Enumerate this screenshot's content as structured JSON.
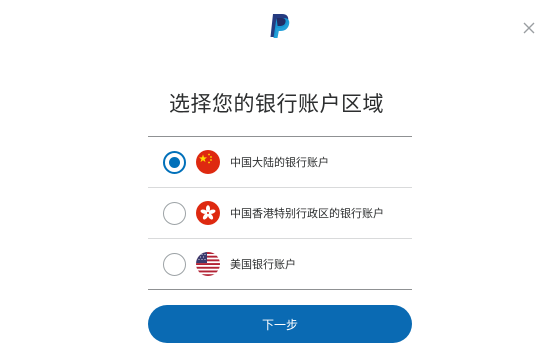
{
  "header": {
    "logo_icon": "paypal-logo",
    "close_icon": "close-icon"
  },
  "title": "选择您的银行账户区域",
  "options": [
    {
      "label": "中国大陆的银行账户",
      "flag_icon": "china-flag-icon",
      "selected": true
    },
    {
      "label": "中国香港特别行政区的银行账户",
      "flag_icon": "hong-kong-flag-icon",
      "selected": false
    },
    {
      "label": "美国银行账户",
      "flag_icon": "usa-flag-icon",
      "selected": false
    }
  ],
  "next_button": {
    "label": "下一步"
  },
  "colors": {
    "accent": "#0070ba",
    "button": "#0a6ab3",
    "text": "#2c2e2f",
    "divider": "#d9dadb"
  }
}
